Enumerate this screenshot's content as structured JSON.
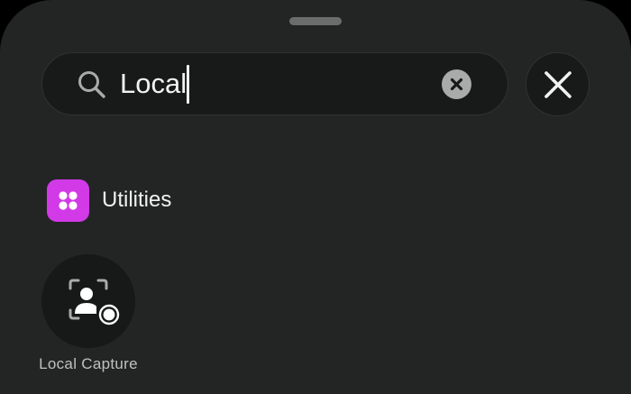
{
  "search": {
    "query": "Local",
    "icon": "magnifying-glass-icon"
  },
  "buttons": {
    "clear_icon": "xmark-circle-fill-icon",
    "close_icon": "xmark-icon"
  },
  "category": {
    "label": "Utilities",
    "icon": "four-dots-grid-icon",
    "color": "#d23ae8"
  },
  "results": [
    {
      "label": "Local Capture",
      "icon": "person-viewfinder-record-icon"
    }
  ],
  "colors": {
    "sheet_background": "#232525",
    "field_background": "#181a1a",
    "text": "#f2f2f2"
  }
}
